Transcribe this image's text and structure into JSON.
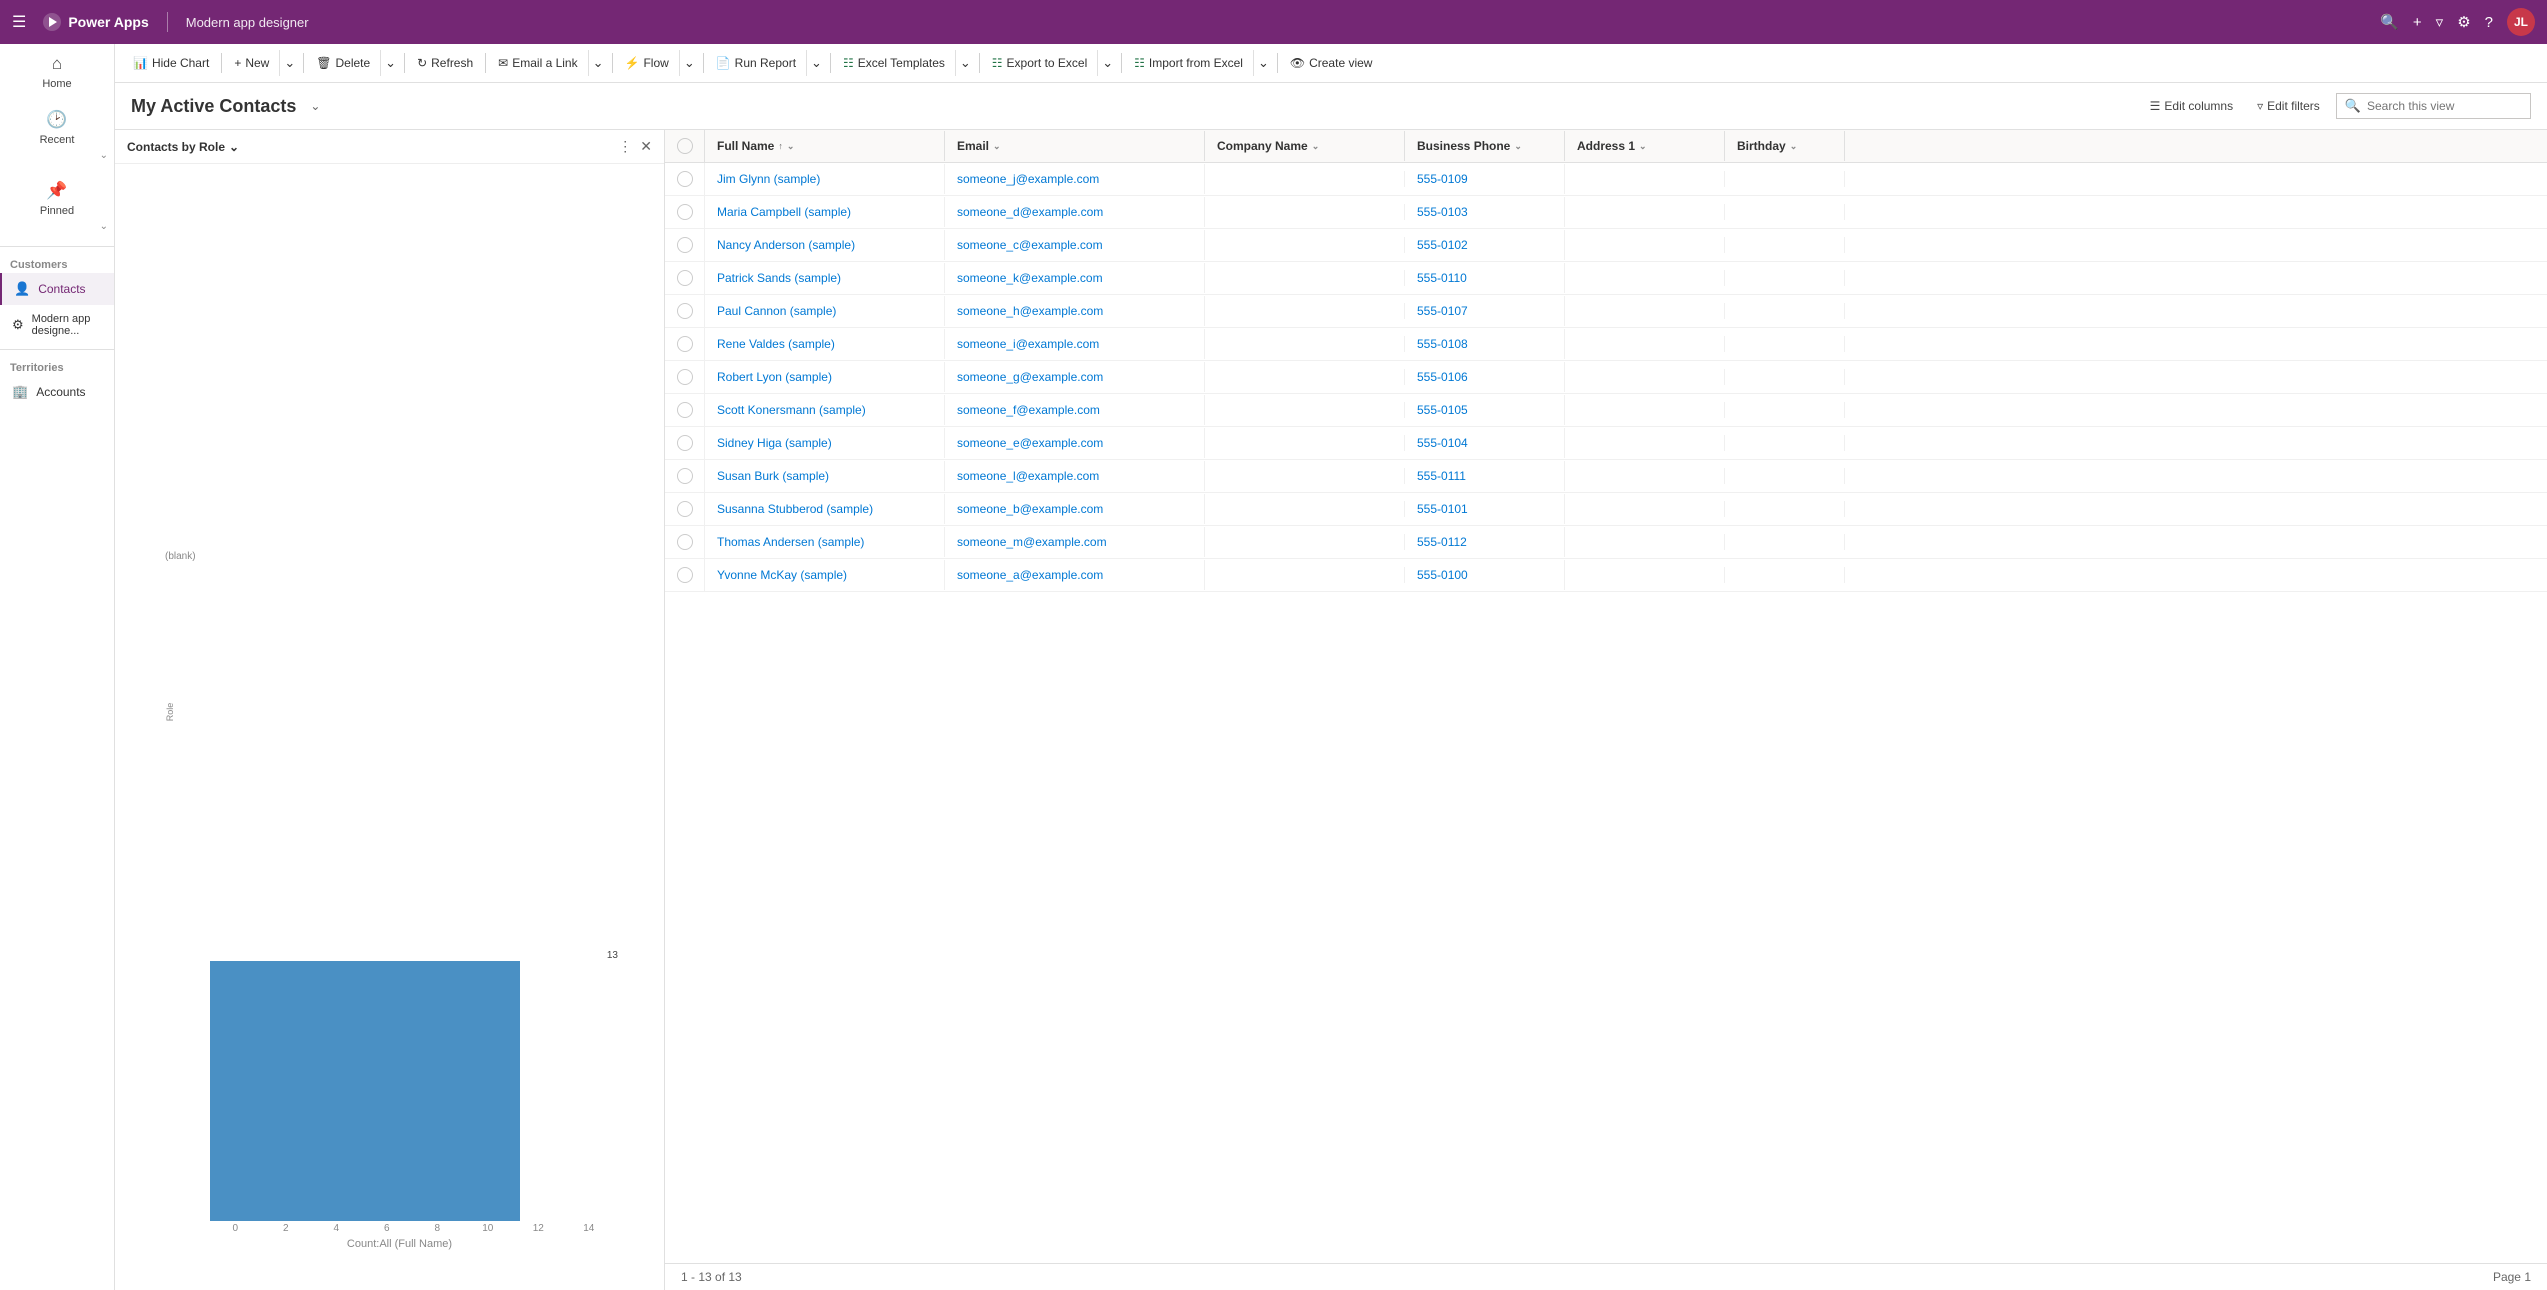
{
  "topbar": {
    "app_name": "Power Apps",
    "title": "Modern app designer",
    "avatar_initials": "JL"
  },
  "sidebar": {
    "home_label": "Home",
    "recent_label": "Recent",
    "pinned_label": "Pinned",
    "customers_label": "Customers",
    "contacts_label": "Contacts",
    "modern_app_label": "Modern app designe...",
    "territories_label": "Territories",
    "accounts_label": "Accounts"
  },
  "command_bar": {
    "hide_chart": "Hide Chart",
    "new": "New",
    "delete": "Delete",
    "refresh": "Refresh",
    "email_link": "Email a Link",
    "flow": "Flow",
    "run_report": "Run Report",
    "excel_templates": "Excel Templates",
    "export_to_excel": "Export to Excel",
    "import_from_excel": "Import from Excel",
    "create_view": "Create view"
  },
  "view_header": {
    "title": "My Active Contacts",
    "edit_columns": "Edit columns",
    "edit_filters": "Edit filters",
    "search_placeholder": "Search this view"
  },
  "chart": {
    "title": "Contacts by Role",
    "blank_label": "(blank)",
    "role_label": "Role",
    "count_label": "13",
    "x_axis_title": "Count:All (Full Name)",
    "x_ticks": [
      "0",
      "2",
      "4",
      "6",
      "8",
      "10",
      "12",
      "14"
    ]
  },
  "grid": {
    "columns": [
      {
        "id": "fullname",
        "label": "Full Name",
        "sort": "↑"
      },
      {
        "id": "email",
        "label": "Email"
      },
      {
        "id": "company",
        "label": "Company Name"
      },
      {
        "id": "phone",
        "label": "Business Phone"
      },
      {
        "id": "address",
        "label": "Address 1"
      },
      {
        "id": "birthday",
        "label": "Birthday"
      }
    ],
    "rows": [
      {
        "fullname": "Jim Glynn (sample)",
        "email": "someone_j@example.com",
        "company": "",
        "phone": "555-0109",
        "address": "",
        "birthday": ""
      },
      {
        "fullname": "Maria Campbell (sample)",
        "email": "someone_d@example.com",
        "company": "",
        "phone": "555-0103",
        "address": "",
        "birthday": ""
      },
      {
        "fullname": "Nancy Anderson (sample)",
        "email": "someone_c@example.com",
        "company": "",
        "phone": "555-0102",
        "address": "",
        "birthday": ""
      },
      {
        "fullname": "Patrick Sands (sample)",
        "email": "someone_k@example.com",
        "company": "",
        "phone": "555-0110",
        "address": "",
        "birthday": ""
      },
      {
        "fullname": "Paul Cannon (sample)",
        "email": "someone_h@example.com",
        "company": "",
        "phone": "555-0107",
        "address": "",
        "birthday": ""
      },
      {
        "fullname": "Rene Valdes (sample)",
        "email": "someone_i@example.com",
        "company": "",
        "phone": "555-0108",
        "address": "",
        "birthday": ""
      },
      {
        "fullname": "Robert Lyon (sample)",
        "email": "someone_g@example.com",
        "company": "",
        "phone": "555-0106",
        "address": "",
        "birthday": ""
      },
      {
        "fullname": "Scott Konersmann (sample)",
        "email": "someone_f@example.com",
        "company": "",
        "phone": "555-0105",
        "address": "",
        "birthday": ""
      },
      {
        "fullname": "Sidney Higa (sample)",
        "email": "someone_e@example.com",
        "company": "",
        "phone": "555-0104",
        "address": "",
        "birthday": ""
      },
      {
        "fullname": "Susan Burk (sample)",
        "email": "someone_l@example.com",
        "company": "",
        "phone": "555-0111",
        "address": "",
        "birthday": ""
      },
      {
        "fullname": "Susanna Stubberod (sample)",
        "email": "someone_b@example.com",
        "company": "",
        "phone": "555-0101",
        "address": "",
        "birthday": ""
      },
      {
        "fullname": "Thomas Andersen (sample)",
        "email": "someone_m@example.com",
        "company": "",
        "phone": "555-0112",
        "address": "",
        "birthday": ""
      },
      {
        "fullname": "Yvonne McKay (sample)",
        "email": "someone_a@example.com",
        "company": "",
        "phone": "555-0100",
        "address": "",
        "birthday": ""
      }
    ],
    "footer": "1 - 13 of 13",
    "page_label": "Page 1"
  }
}
